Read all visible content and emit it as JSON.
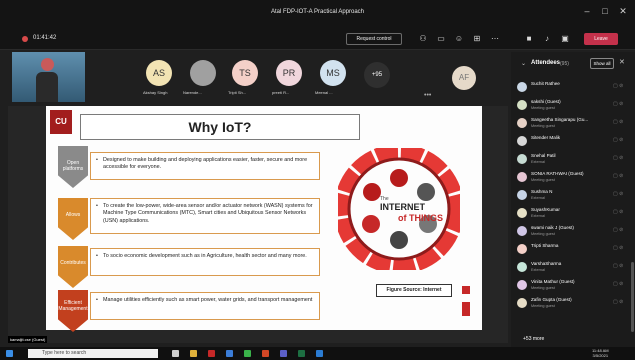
{
  "window": {
    "title": "Atal FDP-IOT-A Practical Approach"
  },
  "toolbar": {
    "timer": "01:41:42",
    "request_control": "Request control",
    "leave": "Leave"
  },
  "participants": [
    {
      "initials": "AS",
      "name": "Akshay Singh",
      "color": "#f2e3b3"
    },
    {
      "initials": "",
      "name": "Narende...",
      "color": "#a0a0a0"
    },
    {
      "initials": "TS",
      "name": "Tripti Sh...",
      "color": "#f4d0c8"
    },
    {
      "initials": "PR",
      "name": "preeti R...",
      "color": "#f0d6dc"
    },
    {
      "initials": "MS",
      "name": "Meenal ...",
      "color": "#d2e2ef"
    }
  ],
  "more_participants": "+95",
  "extra_avatar": "AF",
  "slide": {
    "logo": "CU",
    "title": "Why IoT?",
    "items": [
      {
        "label": "Open platforms",
        "text": "Designed to make building and deploying applications easier, faster, secure and more accessible for everyone."
      },
      {
        "label": "Allows",
        "text": "To create the low-power, wide-area sensor and/or actuator network (WASN) systems for Machine Type Communications (MTC), Smart cities and Ubiquitous Sensor Networks (USN) applications."
      },
      {
        "label": "Contributes",
        "text": "To socio economic development such as in Agriculture, health sector and many more."
      },
      {
        "label": "Efficient Management",
        "text": "Manage utilities efficiently such as smart power, water grids, and transport management"
      }
    ],
    "wheel": {
      "line1": "The",
      "line2": "INTERNET",
      "line3": "of THINGS"
    },
    "figure_source": "Figure Source: Internet",
    "presenter_label": "kamaljit.cse (Guest)"
  },
  "panel": {
    "title": "Attendees",
    "count": "(95)",
    "show_all": "Show all",
    "attendees": [
      {
        "name": "Suchit Rathee",
        "sub": ""
      },
      {
        "name": "sakshi (Guest)",
        "sub": "Meeting guest"
      },
      {
        "name": "Sangeetha Singarapu (Gu...",
        "sub": "Meeting guest"
      },
      {
        "name": "Sitender Malik",
        "sub": ""
      },
      {
        "name": "Snehal Patil",
        "sub": "External"
      },
      {
        "name": "SONIA RATHWAI (Guest)",
        "sub": "Meeting guest"
      },
      {
        "name": "Sushma N",
        "sub": "External"
      },
      {
        "name": "SuyashKumar",
        "sub": "External"
      },
      {
        "name": "swami naik J (Guest)",
        "sub": "Meeting guest"
      },
      {
        "name": "Tripti Sharma",
        "sub": ""
      },
      {
        "name": "VarshaSharma",
        "sub": "External"
      },
      {
        "name": "Vinita Mathur (Guest)",
        "sub": "Meeting guest"
      },
      {
        "name": "Zafin Gupta (Guest)",
        "sub": "Meeting guest"
      }
    ],
    "more": "+53 more"
  },
  "taskbar": {
    "search_placeholder": "Type here to search",
    "time": "11:48 AM",
    "date": "3/5/2021"
  }
}
